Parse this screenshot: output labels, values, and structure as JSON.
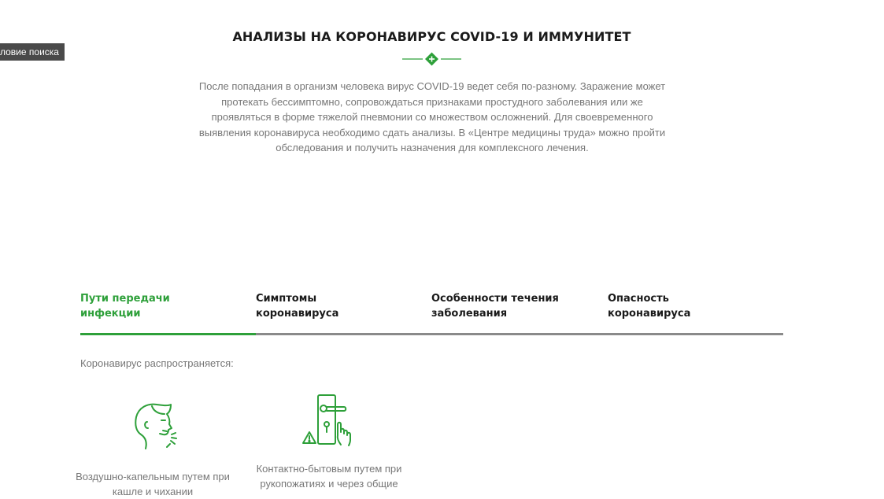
{
  "side_tag": "ловие поиска",
  "section": {
    "title": "АНАЛИЗЫ НА КОРОНАВИРУС COVID-19 И ИММУНИТЕТ",
    "intro": "После попадания в организм человека вирус COVID-19 ведет себя по-разному. Заражение может протекать бессимптомно, сопровождаться признаками простудного заболевания или же проявляться в форме тяжелой пневмонии со множеством осложнений. Для своевременного выявления коронавируса необходимо сдать анализы. В «Центре медицины труда» можно пройти обследования и получить назначения для комплексного лечения.",
    "divider_icon": "plus-diamond-icon"
  },
  "tabs": [
    {
      "label": "Пути передачи инфекции",
      "active": true
    },
    {
      "label": "Симптомы коронавируса",
      "active": false
    },
    {
      "label": "Особенности течения заболевания",
      "active": false
    },
    {
      "label": "Опасность коронавируса",
      "active": false
    }
  ],
  "content": {
    "intro": "Коронавирус распространяется:",
    "cards": [
      {
        "icon": "cough-person-icon",
        "text": "Воздушно-капельным путем при кашле и чихании"
      },
      {
        "icon": "door-handle-touch-icon",
        "text": "Контактно-бытовым путем при рукопожатиях и через общие"
      }
    ]
  },
  "colors": {
    "accent": "#2ea03a",
    "tab_line": "#8a8a8a",
    "muted_text": "#777777",
    "heading": "#1a1a1a",
    "tag_bg": "#4a4a4a"
  }
}
